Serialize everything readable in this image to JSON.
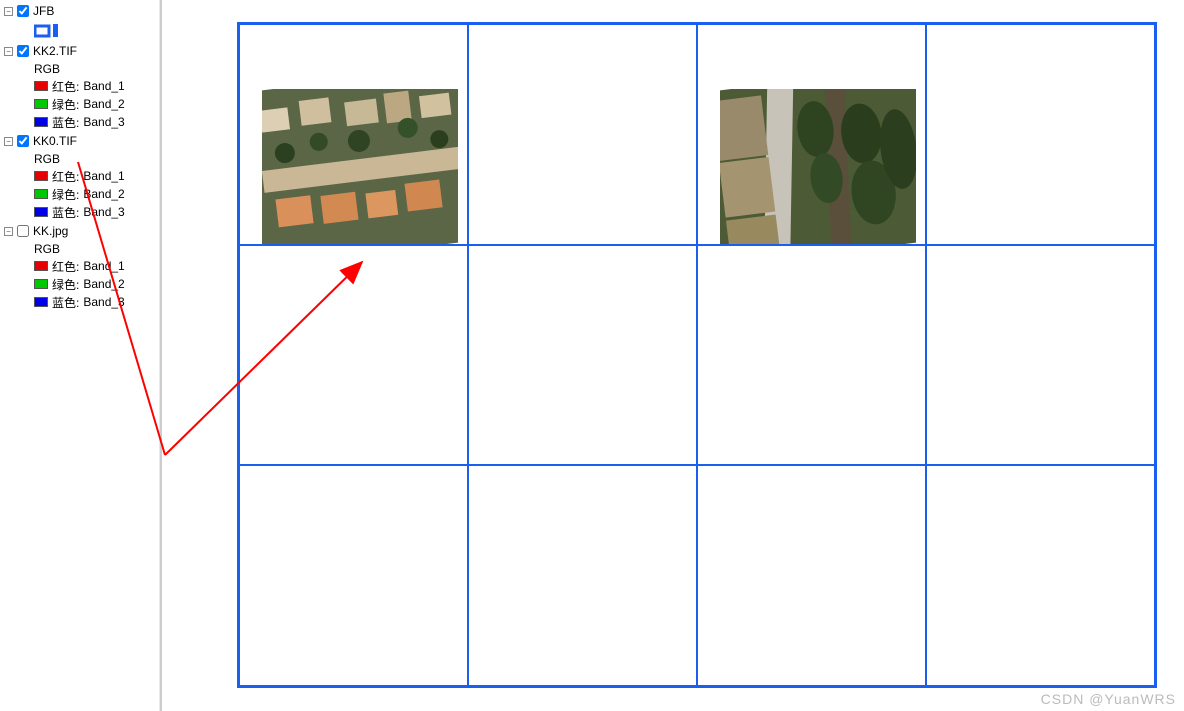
{
  "layers": [
    {
      "name": "JFB",
      "checked": true,
      "rgb_label": null,
      "show_jfb_icon": true,
      "bands": []
    },
    {
      "name": "KK2.TIF",
      "checked": true,
      "rgb_label": "RGB",
      "bands": [
        {
          "color": "red",
          "channel": "红色:",
          "band": "Band_1"
        },
        {
          "color": "green",
          "channel": "绿色:",
          "band": "Band_2"
        },
        {
          "color": "blue",
          "channel": "蓝色:",
          "band": "Band_3"
        }
      ]
    },
    {
      "name": "KK0.TIF",
      "checked": true,
      "rgb_label": "RGB",
      "bands": [
        {
          "color": "red",
          "channel": "红色:",
          "band": "Band_1"
        },
        {
          "color": "green",
          "channel": "绿色:",
          "band": "Band_2"
        },
        {
          "color": "blue",
          "channel": "蓝色:",
          "band": "Band_3"
        }
      ]
    },
    {
      "name": "KK.jpg",
      "checked": false,
      "rgb_label": "RGB",
      "bands": [
        {
          "color": "red",
          "channel": "红色:",
          "band": "Band_1"
        },
        {
          "color": "green",
          "channel": "绿色:",
          "band": "Band_2"
        },
        {
          "color": "blue",
          "channel": "蓝色:",
          "band": "Band_3"
        }
      ]
    }
  ],
  "watermark": "CSDN @YuanWRS"
}
